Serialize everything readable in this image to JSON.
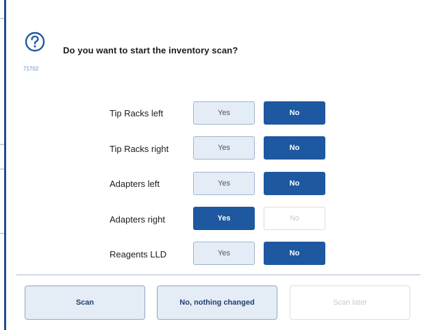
{
  "dialog": {
    "question": "Do you want to start the inventory scan?",
    "code": "71702",
    "icon": "help-circle-icon",
    "colors": {
      "accent": "#1d58a0",
      "inactive_bg": "#e4ecf6",
      "inactive_border": "#9fb3cc",
      "disabled_text": "#c9c9c9"
    }
  },
  "options": [
    {
      "label": "Tip Racks left",
      "yes": "Yes",
      "no": "No",
      "selected": "No",
      "no_disabled": false
    },
    {
      "label": "Tip Racks right",
      "yes": "Yes",
      "no": "No",
      "selected": "No",
      "no_disabled": false
    },
    {
      "label": "Adapters left",
      "yes": "Yes",
      "no": "No",
      "selected": "No",
      "no_disabled": false
    },
    {
      "label": "Adapters right",
      "yes": "Yes",
      "no": "No",
      "selected": "Yes",
      "no_disabled": true
    },
    {
      "label": "Reagents LLD",
      "yes": "Yes",
      "no": "No",
      "selected": "No",
      "no_disabled": false
    }
  ],
  "footer": {
    "scan": "Scan",
    "no_change": "No, nothing changed",
    "scan_later": "Scan later"
  }
}
